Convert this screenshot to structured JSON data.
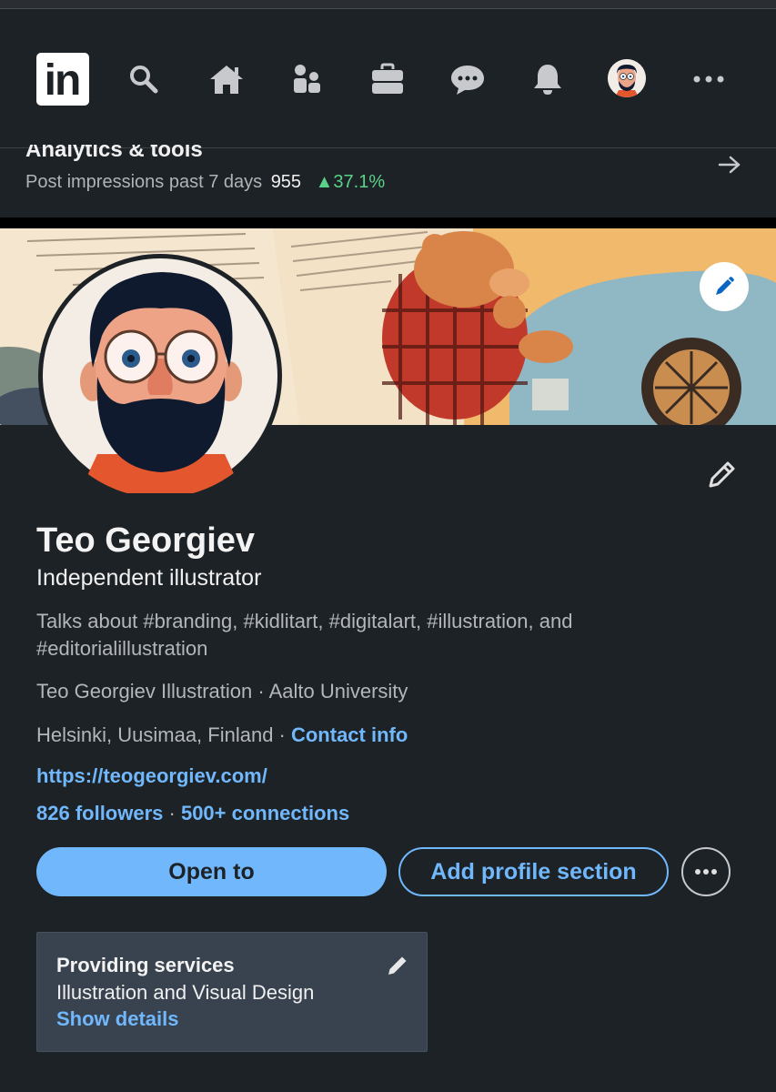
{
  "nav": {
    "logo_text": "in",
    "icons": [
      "search-icon",
      "home-icon",
      "my-network-icon",
      "jobs-icon",
      "messaging-icon",
      "notifications-icon",
      "me-avatar",
      "more-icon"
    ]
  },
  "analytics": {
    "title": "Analytics & tools",
    "impressions_label": "Post impressions past 7 days",
    "impressions_count": "955",
    "impressions_change": "▲37.1%"
  },
  "profile": {
    "name": "Teo Georgiev",
    "headline": "Independent illustrator",
    "talks_about": "Talks about #branding, #kidlitart, #digitalart, #illustration, and #editorialillustration",
    "company": "Teo Georgiev Illustration · Aalto University",
    "location": "Helsinki, Uusimaa, Finland · ",
    "contact_info": "Contact info",
    "website": "https://teogeorgiev.com/",
    "followers": "826 followers",
    "separator": " · ",
    "connections": "500+ connections"
  },
  "actions": {
    "open_to": "Open to",
    "add_section": "Add profile section"
  },
  "services": {
    "title": "Providing services",
    "description": "Illustration and Visual Design",
    "show_details": "Show details"
  },
  "colors": {
    "background": "#1d2226",
    "accent": "#71b7fb",
    "positive": "#5ad28a",
    "services_card": "#38434f"
  }
}
